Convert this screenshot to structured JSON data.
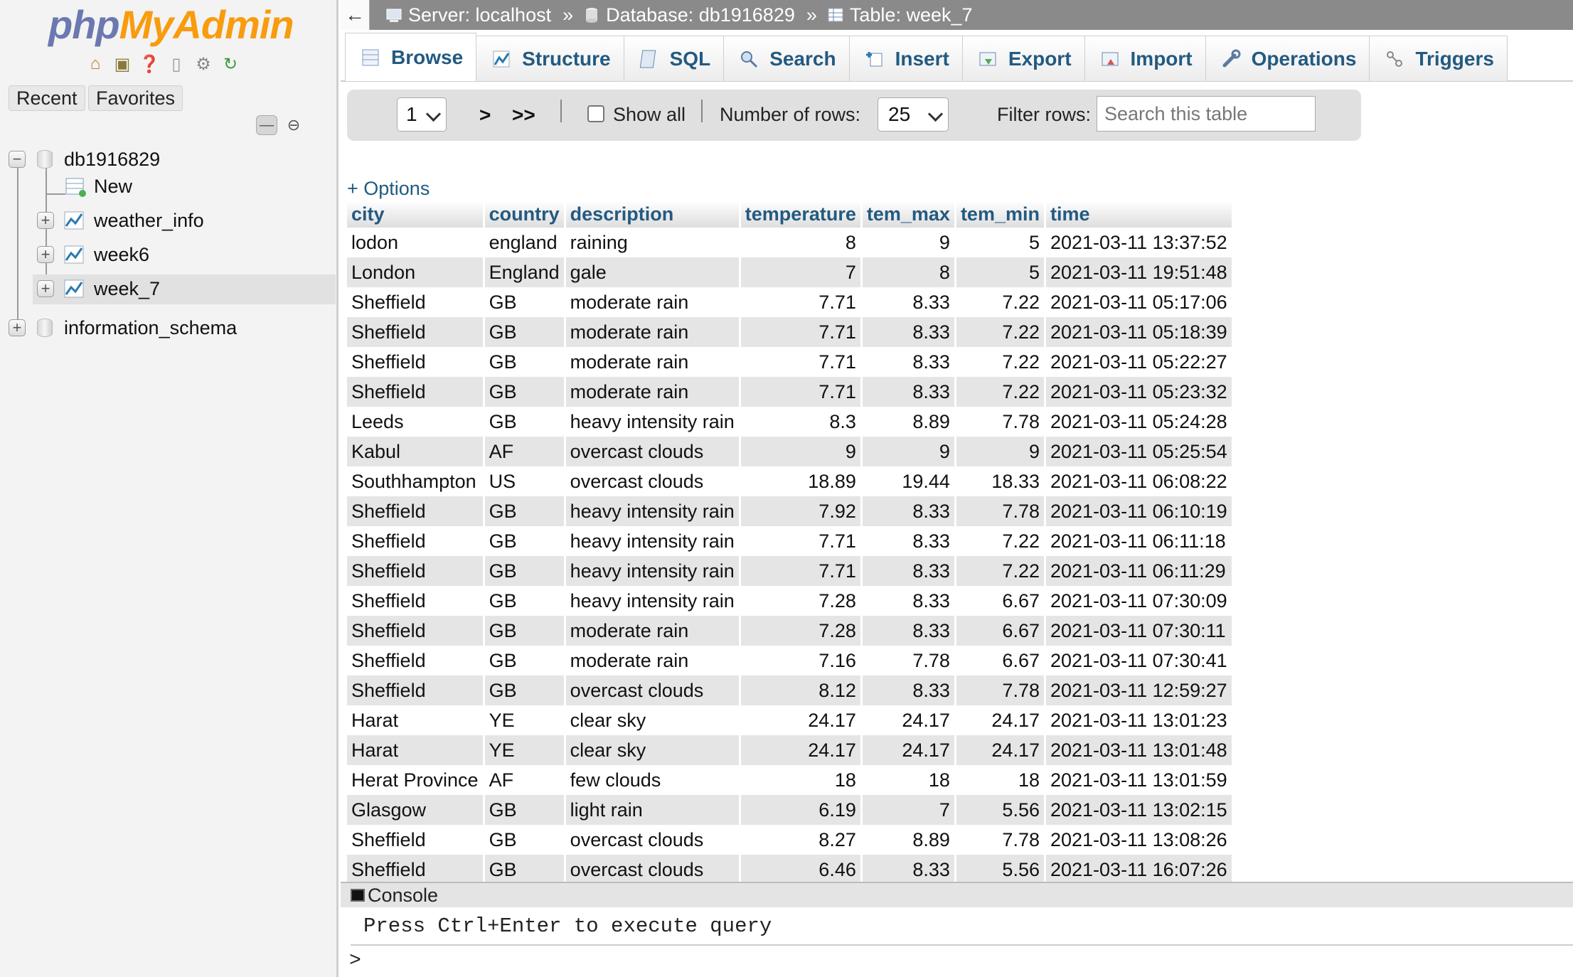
{
  "sidebar": {
    "logo": {
      "php": "php",
      "my": "My",
      "admin": "Admin"
    },
    "logo_icons": [
      "home-icon",
      "exit-icon",
      "help-icon",
      "docs-icon",
      "settings-icon",
      "reload-icon"
    ],
    "recent_label": "Recent",
    "favorites_label": "Favorites",
    "tree": {
      "db1": "db1916829",
      "new": "New",
      "tables": [
        "weather_info",
        "week6",
        "week_7"
      ],
      "selected_table": "week_7",
      "db2": "information_schema"
    }
  },
  "breadcrumb": {
    "server": "Server: localhost",
    "database": "Database: db1916829",
    "table": "Table: week_7",
    "separator": "»"
  },
  "tabs": [
    {
      "label": "Browse",
      "icon": "browse-icon",
      "active": true
    },
    {
      "label": "Structure",
      "icon": "structure-icon"
    },
    {
      "label": "SQL",
      "icon": "sql-icon"
    },
    {
      "label": "Search",
      "icon": "search-icon"
    },
    {
      "label": "Insert",
      "icon": "insert-icon"
    },
    {
      "label": "Export",
      "icon": "export-icon"
    },
    {
      "label": "Import",
      "icon": "import-icon"
    },
    {
      "label": "Operations",
      "icon": "operations-icon"
    },
    {
      "label": "Triggers",
      "icon": "triggers-icon"
    }
  ],
  "navbar": {
    "page_value": "1",
    "next": ">",
    "last": ">>",
    "show_all_label": "Show all",
    "rows_label": "Number of rows:",
    "rows_value": "25",
    "filter_label": "Filter rows:",
    "filter_placeholder": "Search this table"
  },
  "options_label": "+ Options",
  "table": {
    "columns": [
      "city",
      "country",
      "description",
      "temperature",
      "tem_max",
      "tem_min",
      "time"
    ],
    "rows": [
      [
        "lodon",
        "england",
        "raining",
        "8",
        "9",
        "5",
        "2021-03-11 13:37:52"
      ],
      [
        "London",
        "England",
        "gale",
        "7",
        "8",
        "5",
        "2021-03-11 19:51:48"
      ],
      [
        "Sheffield",
        "GB",
        "moderate rain",
        "7.71",
        "8.33",
        "7.22",
        "2021-03-11 05:17:06"
      ],
      [
        "Sheffield",
        "GB",
        "moderate rain",
        "7.71",
        "8.33",
        "7.22",
        "2021-03-11 05:18:39"
      ],
      [
        "Sheffield",
        "GB",
        "moderate rain",
        "7.71",
        "8.33",
        "7.22",
        "2021-03-11 05:22:27"
      ],
      [
        "Sheffield",
        "GB",
        "moderate rain",
        "7.71",
        "8.33",
        "7.22",
        "2021-03-11 05:23:32"
      ],
      [
        "Leeds",
        "GB",
        "heavy intensity rain",
        "8.3",
        "8.89",
        "7.78",
        "2021-03-11 05:24:28"
      ],
      [
        "Kabul",
        "AF",
        "overcast clouds",
        "9",
        "9",
        "9",
        "2021-03-11 05:25:54"
      ],
      [
        "Southhampton",
        "US",
        "overcast clouds",
        "18.89",
        "19.44",
        "18.33",
        "2021-03-11 06:08:22"
      ],
      [
        "Sheffield",
        "GB",
        "heavy intensity rain",
        "7.92",
        "8.33",
        "7.78",
        "2021-03-11 06:10:19"
      ],
      [
        "Sheffield",
        "GB",
        "heavy intensity rain",
        "7.71",
        "8.33",
        "7.22",
        "2021-03-11 06:11:18"
      ],
      [
        "Sheffield",
        "GB",
        "heavy intensity rain",
        "7.71",
        "8.33",
        "7.22",
        "2021-03-11 06:11:29"
      ],
      [
        "Sheffield",
        "GB",
        "heavy intensity rain",
        "7.28",
        "8.33",
        "6.67",
        "2021-03-11 07:30:09"
      ],
      [
        "Sheffield",
        "GB",
        "moderate rain",
        "7.28",
        "8.33",
        "6.67",
        "2021-03-11 07:30:11"
      ],
      [
        "Sheffield",
        "GB",
        "moderate rain",
        "7.16",
        "7.78",
        "6.67",
        "2021-03-11 07:30:41"
      ],
      [
        "Sheffield",
        "GB",
        "overcast clouds",
        "8.12",
        "8.33",
        "7.78",
        "2021-03-11 12:59:27"
      ],
      [
        "Harat",
        "YE",
        "clear sky",
        "24.17",
        "24.17",
        "24.17",
        "2021-03-11 13:01:23"
      ],
      [
        "Harat",
        "YE",
        "clear sky",
        "24.17",
        "24.17",
        "24.17",
        "2021-03-11 13:01:48"
      ],
      [
        "Herat Province",
        "AF",
        "few clouds",
        "18",
        "18",
        "18",
        "2021-03-11 13:01:59"
      ],
      [
        "Glasgow",
        "GB",
        "light rain",
        "6.19",
        "7",
        "5.56",
        "2021-03-11 13:02:15"
      ],
      [
        "Sheffield",
        "GB",
        "overcast clouds",
        "8.27",
        "8.89",
        "7.78",
        "2021-03-11 13:08:26"
      ],
      [
        "Sheffield",
        "GB",
        "overcast clouds",
        "6.46",
        "8.33",
        "5.56",
        "2021-03-11 16:07:26"
      ]
    ]
  },
  "console": {
    "title": "Console",
    "hint": "Press Ctrl+Enter to execute query",
    "prompt": ">"
  },
  "colors": {
    "link_blue": "#235a81",
    "logo_blue": "#6c78af",
    "logo_orange": "#f89c0e",
    "topbar_gray": "#8a8a8a"
  }
}
